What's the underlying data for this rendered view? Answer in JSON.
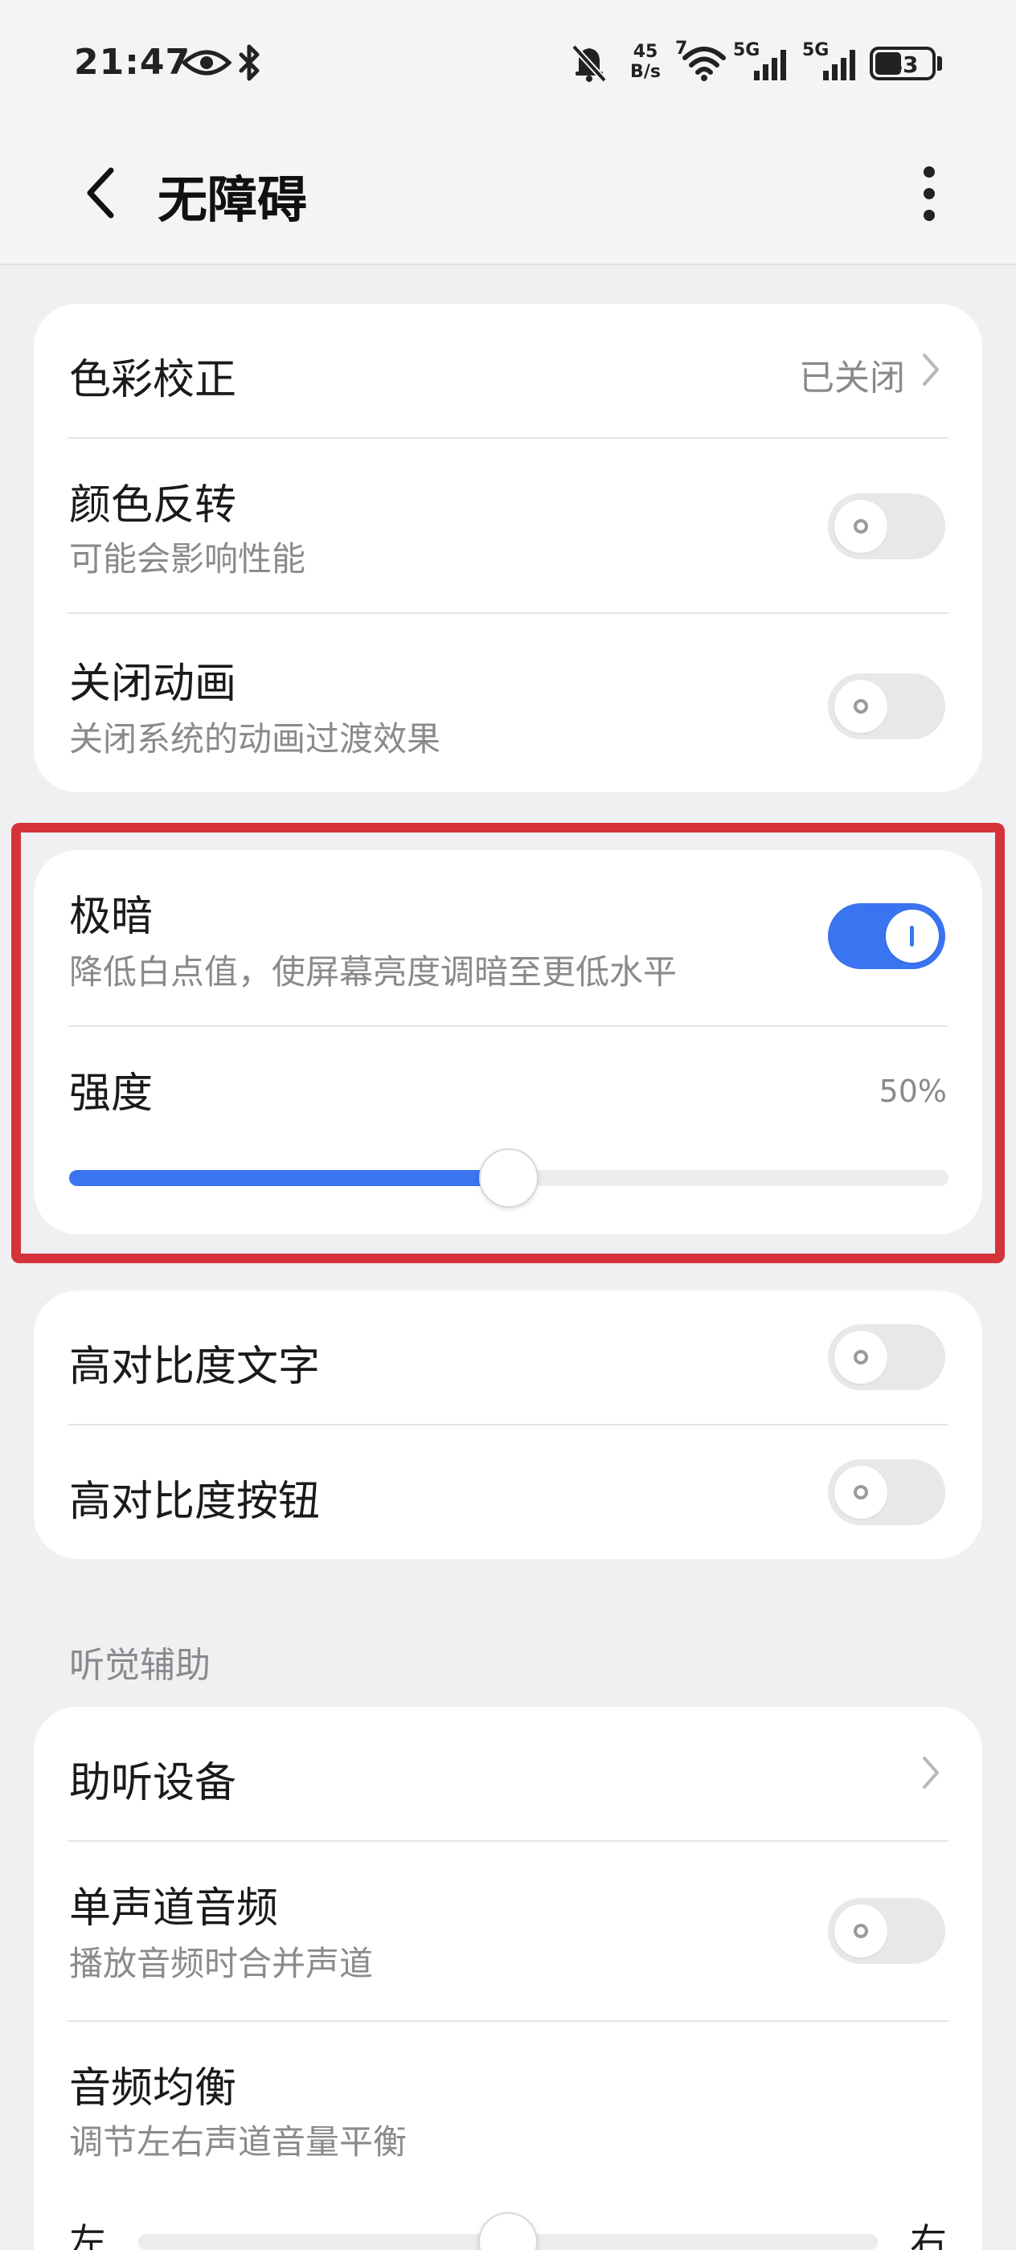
{
  "status_bar": {
    "time": "21:47",
    "net_speed_value": "45",
    "net_speed_unit": "B/s",
    "signal_1_label": "5G",
    "signal_2_label": "5G",
    "wifi_badge": "7",
    "battery": "43"
  },
  "header": {
    "title": "无障碍"
  },
  "display_card": {
    "color_correction": {
      "title": "色彩校正",
      "value": "已关闭"
    },
    "color_inversion": {
      "title": "颜色反转",
      "subtitle": "可能会影响性能",
      "enabled": false
    },
    "disable_animation": {
      "title": "关闭动画",
      "subtitle": "关闭系统的动画过渡效果",
      "enabled": false
    }
  },
  "extra_dim_card": {
    "extra_dim": {
      "title": "极暗",
      "subtitle": "降低白点值，使屏幕亮度调暗至更低水平",
      "enabled": true
    },
    "intensity": {
      "title": "强度",
      "value_label": "50%",
      "value": 0.5
    }
  },
  "contrast_card": {
    "high_contrast_text": {
      "title": "高对比度文字",
      "enabled": false
    },
    "high_contrast_buttons": {
      "title": "高对比度按钮",
      "enabled": false
    }
  },
  "hearing_section": {
    "label": "听觉辅助",
    "hearing_devices": {
      "title": "助听设备"
    },
    "mono_audio": {
      "title": "单声道音频",
      "subtitle": "播放音频时合并声道",
      "enabled": false
    },
    "audio_balance": {
      "title": "音频均衡",
      "subtitle": "调节左右声道音量平衡",
      "left_label": "左",
      "right_label": "右",
      "value": 0.5
    }
  },
  "colors": {
    "accent": "#3a74f0",
    "highlight_border": "#d4333a",
    "background": "#f0f0f2",
    "card": "#ffffff"
  }
}
